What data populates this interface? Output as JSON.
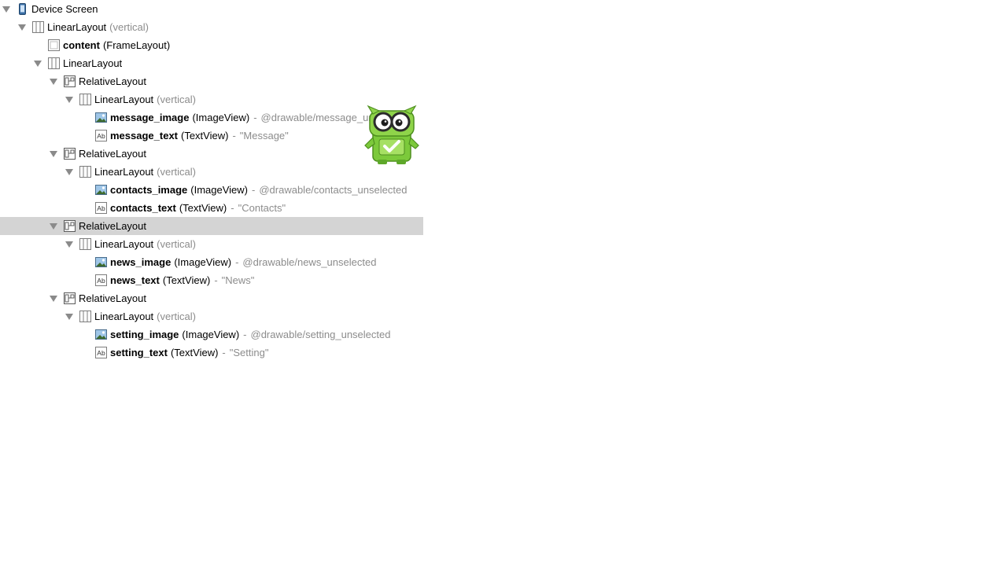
{
  "tree": [
    {
      "depth": 0,
      "expanded": true,
      "icon": "device-icon",
      "name": "Device Screen",
      "bold": false,
      "type": "",
      "value": "",
      "selected": false
    },
    {
      "depth": 1,
      "expanded": true,
      "icon": "linear-layout-icon",
      "name": "LinearLayout",
      "bold": false,
      "type": "(vertical)",
      "value": "",
      "selected": false
    },
    {
      "depth": 2,
      "expanded": null,
      "icon": "frame-layout-icon",
      "name": "content",
      "bold": true,
      "type": "(FrameLayout)",
      "value": "",
      "selected": false
    },
    {
      "depth": 2,
      "expanded": true,
      "icon": "linear-layout-icon",
      "name": "LinearLayout",
      "bold": false,
      "type": "",
      "value": "",
      "selected": false
    },
    {
      "depth": 3,
      "expanded": true,
      "icon": "relative-layout-icon",
      "name": "RelativeLayout",
      "bold": false,
      "type": "",
      "value": "",
      "selected": false
    },
    {
      "depth": 4,
      "expanded": true,
      "icon": "linear-layout-icon",
      "name": "LinearLayout",
      "bold": false,
      "type": "(vertical)",
      "value": "",
      "selected": false
    },
    {
      "depth": 5,
      "expanded": null,
      "icon": "image-view-icon",
      "name": "message_image",
      "bold": true,
      "type": "(ImageView)",
      "value": "@drawable/message_unselected",
      "selected": false
    },
    {
      "depth": 5,
      "expanded": null,
      "icon": "text-view-icon",
      "name": "message_text",
      "bold": true,
      "type": "(TextView)",
      "value": "\"Message\"",
      "selected": false
    },
    {
      "depth": 3,
      "expanded": true,
      "icon": "relative-layout-icon",
      "name": "RelativeLayout",
      "bold": false,
      "type": "",
      "value": "",
      "selected": false
    },
    {
      "depth": 4,
      "expanded": true,
      "icon": "linear-layout-icon",
      "name": "LinearLayout",
      "bold": false,
      "type": "(vertical)",
      "value": "",
      "selected": false
    },
    {
      "depth": 5,
      "expanded": null,
      "icon": "image-view-icon",
      "name": "contacts_image",
      "bold": true,
      "type": "(ImageView)",
      "value": "@drawable/contacts_unselected",
      "selected": false
    },
    {
      "depth": 5,
      "expanded": null,
      "icon": "text-view-icon",
      "name": "contacts_text",
      "bold": true,
      "type": "(TextView)",
      "value": "\"Contacts\"",
      "selected": false
    },
    {
      "depth": 3,
      "expanded": true,
      "icon": "relative-layout-icon",
      "name": "RelativeLayout",
      "bold": false,
      "type": "",
      "value": "",
      "selected": true
    },
    {
      "depth": 4,
      "expanded": true,
      "icon": "linear-layout-icon",
      "name": "LinearLayout",
      "bold": false,
      "type": "(vertical)",
      "value": "",
      "selected": false
    },
    {
      "depth": 5,
      "expanded": null,
      "icon": "image-view-icon",
      "name": "news_image",
      "bold": true,
      "type": "(ImageView)",
      "value": "@drawable/news_unselected",
      "selected": false
    },
    {
      "depth": 5,
      "expanded": null,
      "icon": "text-view-icon",
      "name": "news_text",
      "bold": true,
      "type": "(TextView)",
      "value": "\"News\"",
      "selected": false
    },
    {
      "depth": 3,
      "expanded": true,
      "icon": "relative-layout-icon",
      "name": "RelativeLayout",
      "bold": false,
      "type": "",
      "value": "",
      "selected": false
    },
    {
      "depth": 4,
      "expanded": true,
      "icon": "linear-layout-icon",
      "name": "LinearLayout",
      "bold": false,
      "type": "(vertical)",
      "value": "",
      "selected": false
    },
    {
      "depth": 5,
      "expanded": null,
      "icon": "image-view-icon",
      "name": "setting_image",
      "bold": true,
      "type": "(ImageView)",
      "value": "@drawable/setting_unselected",
      "selected": false
    },
    {
      "depth": 5,
      "expanded": null,
      "icon": "text-view-icon",
      "name": "setting_text",
      "bold": true,
      "type": "(TextView)",
      "value": "\"Setting\"",
      "selected": false
    }
  ],
  "separator": "-",
  "text_view_glyph": "Ab",
  "colors": {
    "selected_row": "#d4d4d4",
    "meta_text": "#8c8c8c",
    "arrow": "#8a8a8a",
    "mascot_green": "#7cc93b"
  },
  "mascot": {
    "icon": "android-mascot-icon"
  }
}
